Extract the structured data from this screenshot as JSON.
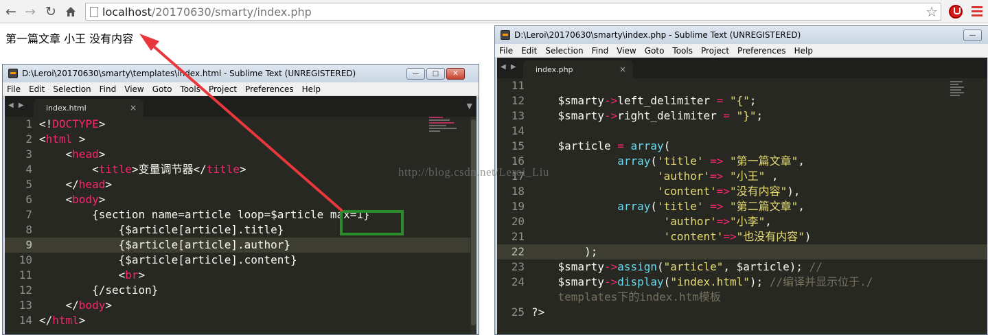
{
  "browser": {
    "url_host": "localhost",
    "url_path": "/20170630/smarty/index.php",
    "back_icon": "back-arrow-icon",
    "forward_icon": "forward-arrow-icon",
    "reload_icon": "reload-icon",
    "home_icon": "home-icon",
    "bookmark_icon": "star-icon",
    "menu_icon": "hamburger-menu-icon"
  },
  "page_output": "第一篇文章 小王 没有内容",
  "left_window": {
    "title": "D:\\Leroi\\20170630\\smarty\\templates\\index.html - Sublime Text (UNREGISTERED)",
    "menu": [
      "File",
      "Edit",
      "Selection",
      "Find",
      "View",
      "Goto",
      "Tools",
      "Project",
      "Preferences",
      "Help"
    ],
    "tab": "index.html",
    "current_line": 9,
    "lines": [
      {
        "n": "1",
        "tokens": [
          [
            "p",
            "<!"
          ],
          [
            "k",
            "DOCTYPE"
          ],
          [
            "p",
            ">"
          ]
        ]
      },
      {
        "n": "2",
        "tokens": [
          [
            "p",
            "<"
          ],
          [
            "k",
            "html"
          ],
          [
            "p",
            " >"
          ]
        ]
      },
      {
        "n": "3",
        "tokens": [
          [
            "p",
            "    <"
          ],
          [
            "k",
            "head"
          ],
          [
            "p",
            ">"
          ]
        ]
      },
      {
        "n": "4",
        "tokens": [
          [
            "p",
            "        <"
          ],
          [
            "k",
            "title"
          ],
          [
            "p",
            ">变量调节器</"
          ],
          [
            "k",
            "title"
          ],
          [
            "p",
            ">"
          ]
        ]
      },
      {
        "n": "5",
        "tokens": [
          [
            "p",
            "    </"
          ],
          [
            "k",
            "head"
          ],
          [
            "p",
            ">"
          ]
        ]
      },
      {
        "n": "6",
        "tokens": [
          [
            "p",
            "    <"
          ],
          [
            "k",
            "body"
          ],
          [
            "p",
            ">"
          ]
        ]
      },
      {
        "n": "7",
        "tokens": [
          [
            "p",
            "        {section name=article loop=$article max=1}"
          ]
        ]
      },
      {
        "n": "8",
        "tokens": [
          [
            "p",
            "            {$article[article].title}"
          ]
        ]
      },
      {
        "n": "9",
        "tokens": [
          [
            "p",
            "            {$article[article].author}"
          ]
        ]
      },
      {
        "n": "10",
        "tokens": [
          [
            "p",
            "            {$article[article].content}"
          ]
        ]
      },
      {
        "n": "11",
        "tokens": [
          [
            "p",
            "            <"
          ],
          [
            "k",
            "br"
          ],
          [
            "p",
            ">"
          ]
        ]
      },
      {
        "n": "12",
        "tokens": [
          [
            "p",
            "        {/section}"
          ]
        ]
      },
      {
        "n": "13",
        "tokens": [
          [
            "p",
            "    </"
          ],
          [
            "k",
            "body"
          ],
          [
            "p",
            ">"
          ]
        ]
      },
      {
        "n": "14",
        "tokens": [
          [
            "p",
            "</"
          ],
          [
            "k",
            "html"
          ],
          [
            "p",
            ">"
          ]
        ]
      }
    ]
  },
  "right_window": {
    "title": "D:\\Leroi\\20170630\\smarty\\index.php - Sublime Text (UNREGISTERED)",
    "menu": [
      "File",
      "Edit",
      "Selection",
      "Find",
      "View",
      "Goto",
      "Tools",
      "Project",
      "Preferences",
      "Help"
    ],
    "tab": "index.php",
    "current_line": 22,
    "lines": [
      {
        "n": "11",
        "tokens": [
          [
            "p",
            ""
          ]
        ]
      },
      {
        "n": "12",
        "tokens": [
          [
            "p",
            "    $smarty"
          ],
          [
            "k",
            "->"
          ],
          [
            "p",
            "left_delimiter "
          ],
          [
            "k",
            "="
          ],
          [
            "p",
            " "
          ],
          [
            "s",
            "\"{\""
          ],
          [
            "p",
            ";"
          ]
        ]
      },
      {
        "n": "13",
        "tokens": [
          [
            "p",
            "    $smarty"
          ],
          [
            "k",
            "->"
          ],
          [
            "p",
            "right_delimiter "
          ],
          [
            "k",
            "="
          ],
          [
            "p",
            " "
          ],
          [
            "s",
            "\"}\""
          ],
          [
            "p",
            ";"
          ]
        ]
      },
      {
        "n": "14",
        "tokens": [
          [
            "p",
            ""
          ]
        ]
      },
      {
        "n": "15",
        "tokens": [
          [
            "p",
            "    $article "
          ],
          [
            "k",
            "="
          ],
          [
            "p",
            " "
          ],
          [
            "f",
            "array"
          ],
          [
            "p",
            "("
          ]
        ]
      },
      {
        "n": "16",
        "tokens": [
          [
            "p",
            "             "
          ],
          [
            "f",
            "array"
          ],
          [
            "p",
            "("
          ],
          [
            "s",
            "'title'"
          ],
          [
            "p",
            " "
          ],
          [
            "k",
            "=>"
          ],
          [
            "p",
            " "
          ],
          [
            "s",
            "\"第一篇文章\""
          ],
          [
            "p",
            ","
          ]
        ]
      },
      {
        "n": "17",
        "tokens": [
          [
            "p",
            "                   "
          ],
          [
            "s",
            "'author'"
          ],
          [
            "k",
            "=>"
          ],
          [
            "p",
            " "
          ],
          [
            "s",
            "\"小王\""
          ],
          [
            "p",
            " ,"
          ]
        ]
      },
      {
        "n": "18",
        "tokens": [
          [
            "p",
            "                   "
          ],
          [
            "s",
            "'content'"
          ],
          [
            "k",
            "=>"
          ],
          [
            "s",
            "\"没有内容\""
          ],
          [
            "p",
            "),"
          ]
        ]
      },
      {
        "n": "19",
        "tokens": [
          [
            "p",
            "             "
          ],
          [
            "f",
            "array"
          ],
          [
            "p",
            "("
          ],
          [
            "s",
            "'title'"
          ],
          [
            "p",
            " "
          ],
          [
            "k",
            "=>"
          ],
          [
            "p",
            " "
          ],
          [
            "s",
            "\"第二篇文章\""
          ],
          [
            "p",
            ","
          ]
        ]
      },
      {
        "n": "20",
        "tokens": [
          [
            "p",
            "                    "
          ],
          [
            "s",
            "'author'"
          ],
          [
            "k",
            "=>"
          ],
          [
            "s",
            "\"小李\""
          ],
          [
            "p",
            ","
          ]
        ]
      },
      {
        "n": "21",
        "tokens": [
          [
            "p",
            "                    "
          ],
          [
            "s",
            "'content'"
          ],
          [
            "k",
            "=>"
          ],
          [
            "s",
            "\"也没有内容\""
          ],
          [
            "p",
            ")"
          ]
        ]
      },
      {
        "n": "22",
        "tokens": [
          [
            "p",
            "        );"
          ]
        ]
      },
      {
        "n": "23",
        "tokens": [
          [
            "p",
            "    $smarty"
          ],
          [
            "k",
            "->"
          ],
          [
            "f",
            "assign"
          ],
          [
            "p",
            "("
          ],
          [
            "s",
            "\"article\""
          ],
          [
            "p",
            ", $article); "
          ],
          [
            "c",
            "//"
          ]
        ]
      },
      {
        "n": "24",
        "tokens": [
          [
            "p",
            "    $smarty"
          ],
          [
            "k",
            "->"
          ],
          [
            "f",
            "display"
          ],
          [
            "p",
            "("
          ],
          [
            "s",
            "\"index.html\""
          ],
          [
            "p",
            "); "
          ],
          [
            "c",
            "//编译并显示位于./"
          ]
        ]
      },
      {
        "n": "",
        "tokens": [
          [
            "c",
            "    templates下的index.htm模板"
          ]
        ]
      },
      {
        "n": "25",
        "tokens": [
          [
            "p",
            "?>"
          ]
        ]
      }
    ]
  },
  "watermark": "http://blog.csdn.net/Leroi_Liu",
  "annotation": {
    "highlighted_code": "max=1",
    "box_color": "#2c8c2c",
    "arrow_color": "#e8383b"
  }
}
